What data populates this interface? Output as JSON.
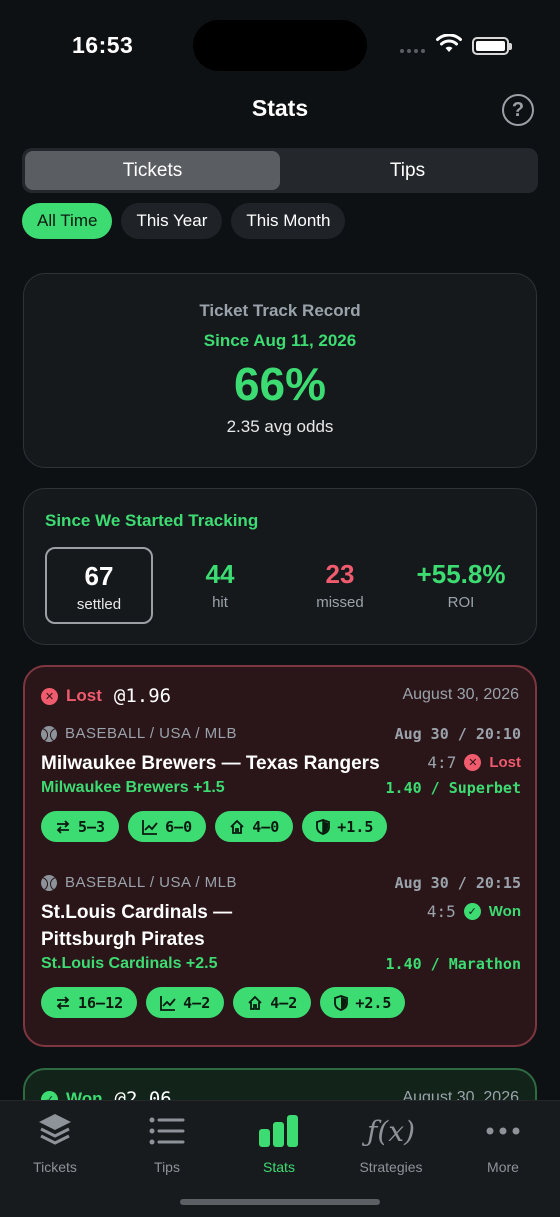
{
  "status_bar": {
    "time": "16:53"
  },
  "header": {
    "title": "Stats",
    "help": "?"
  },
  "segments": [
    {
      "label": "Tickets",
      "active": true
    },
    {
      "label": "Tips",
      "active": false
    }
  ],
  "filters": [
    {
      "label": "All Time",
      "active": true
    },
    {
      "label": "This Year",
      "active": false
    },
    {
      "label": "This Month",
      "active": false
    }
  ],
  "record": {
    "label": "Ticket Track Record",
    "since": "Since Aug 11, 2026",
    "percent": "66%",
    "avg_odds": "2.35 avg odds"
  },
  "tracking": {
    "title": "Since We Started Tracking",
    "settled": {
      "value": "67",
      "label": "settled"
    },
    "hit": {
      "value": "44",
      "label": "hit"
    },
    "missed": {
      "value": "23",
      "label": "missed"
    },
    "roi": {
      "value": "+55.8%",
      "label": "ROI"
    }
  },
  "tickets": [
    {
      "status": "Lost",
      "status_icon": "x-circle-icon",
      "odds": "@1.96",
      "date": "August 30, 2026",
      "legs": [
        {
          "meta": "BASEBALL / USA / MLB",
          "kickoff": "Aug 30 / 20:10",
          "match": "Milwaukee Brewers — Texas Rangers",
          "score": "4:7",
          "result": "Lost",
          "pick": "Milwaukee Brewers +1.5",
          "price": "1.40 / Superbet",
          "pills": [
            "5–3",
            "6–0",
            "4–0",
            "+1.5"
          ]
        },
        {
          "meta": "BASEBALL / USA / MLB",
          "kickoff": "Aug 30 / 20:15",
          "match": "St.Louis Cardinals — Pittsburgh Pirates",
          "score": "4:5",
          "result": "Won",
          "pick": "St.Louis Cardinals +2.5",
          "price": "1.40 / Marathon",
          "pills": [
            "16–12",
            "4–2",
            "4–2",
            "+2.5"
          ]
        }
      ]
    },
    {
      "status": "Won",
      "status_icon": "check-circle-icon",
      "odds": "@2.06",
      "date": "August 30, 2026"
    }
  ],
  "tabbar": [
    {
      "label": "Tickets",
      "icon": "stack-icon",
      "active": false
    },
    {
      "label": "Tips",
      "icon": "list-icon",
      "active": false
    },
    {
      "label": "Stats",
      "icon": "bar-chart-icon",
      "active": true
    },
    {
      "label": "Strategies",
      "icon": "function-icon",
      "active": false
    },
    {
      "label": "More",
      "icon": "ellipsis-icon",
      "active": false
    }
  ],
  "colors": {
    "accent": "#3ddc73",
    "loss": "#f05b6d",
    "background": "#0e1113"
  }
}
